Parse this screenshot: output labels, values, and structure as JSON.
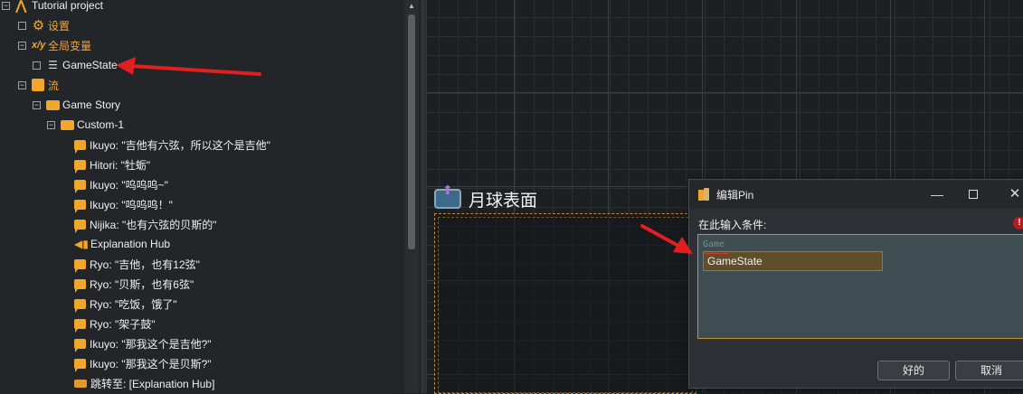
{
  "tree": {
    "root": "Tutorial project",
    "settings": "设置",
    "globals": "全局变量",
    "gamestate": "GameState",
    "flow": "流",
    "game_story": "Game Story",
    "custom": "Custom-1",
    "lines": [
      "Ikuyo: \"吉他有六弦，所以这个是吉他\"",
      "Hitori: \"牡蛎\"",
      "Ikuyo: \"呜呜呜~\"",
      "Ikuyo: \"呜呜呜！\"",
      "Nijika: \"也有六弦的贝斯的\"",
      "Explanation Hub",
      "Ryo: \"吉他，也有12弦\"",
      "Ryo: \"贝斯，也有6弦\"",
      "Ryo: \"吃饭，饿了\"",
      "Ryo: \"架子鼓\"",
      "Ikuyo: \"那我这个是吉他?\"",
      "Ikuyo: \"那我这个是贝斯?\"",
      "跳转至:  [Explanation Hub]"
    ]
  },
  "canvas": {
    "node_title": "月球表面"
  },
  "dialog": {
    "title": "编辑Pin",
    "prompt": "在此输入条件:",
    "warning": "!",
    "editor_hint": "Game",
    "editor_value": "GameState",
    "ok": "好的",
    "cancel": "取消",
    "minimize": "—",
    "close": "✕"
  },
  "colors": {
    "accent_orange": "#f3a72a",
    "arrow_red": "#e02020"
  }
}
